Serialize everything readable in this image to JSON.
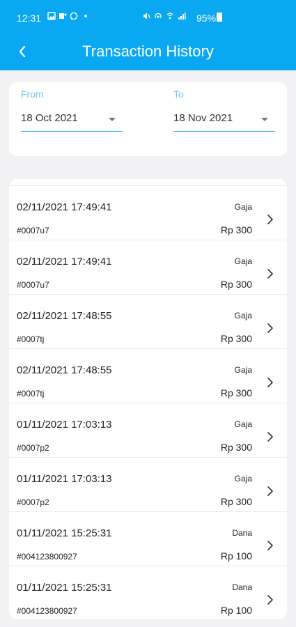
{
  "status_bar": {
    "time": "12:31",
    "battery": "95%"
  },
  "app_bar": {
    "title": "Transaction History",
    "back_icon": "chevron-left-icon"
  },
  "filters": {
    "from": {
      "label": "From",
      "value": "18 Oct 2021"
    },
    "to": {
      "label": "To",
      "value": "18 Nov 2021"
    }
  },
  "transactions": [
    {
      "datetime": "02/11/2021 17:49:41",
      "code": "#0007u7",
      "merchant": "Gaja",
      "amount": "Rp 300"
    },
    {
      "datetime": "02/11/2021 17:49:41",
      "code": "#0007u7",
      "merchant": "Gaja",
      "amount": "Rp 300"
    },
    {
      "datetime": "02/11/2021 17:48:55",
      "code": "#0007tj",
      "merchant": "Gaja",
      "amount": "Rp 300"
    },
    {
      "datetime": "02/11/2021 17:48:55",
      "code": "#0007tj",
      "merchant": "Gaja",
      "amount": "Rp 300"
    },
    {
      "datetime": "01/11/2021 17:03:13",
      "code": "#0007p2",
      "merchant": "Gaja",
      "amount": "Rp 300"
    },
    {
      "datetime": "01/11/2021 17:03:13",
      "code": "#0007p2",
      "merchant": "Gaja",
      "amount": "Rp 300"
    },
    {
      "datetime": "01/11/2021 15:25:31",
      "code": "#004123800927",
      "merchant": "Dana",
      "amount": "Rp 100"
    },
    {
      "datetime": "01/11/2021 15:25:31",
      "code": "#004123800927",
      "merchant": "Dana",
      "amount": "Rp 100"
    }
  ],
  "colors": {
    "primary": "#0ba8f2",
    "background": "#f2f2f4",
    "label_accent": "#6ec8ef"
  }
}
